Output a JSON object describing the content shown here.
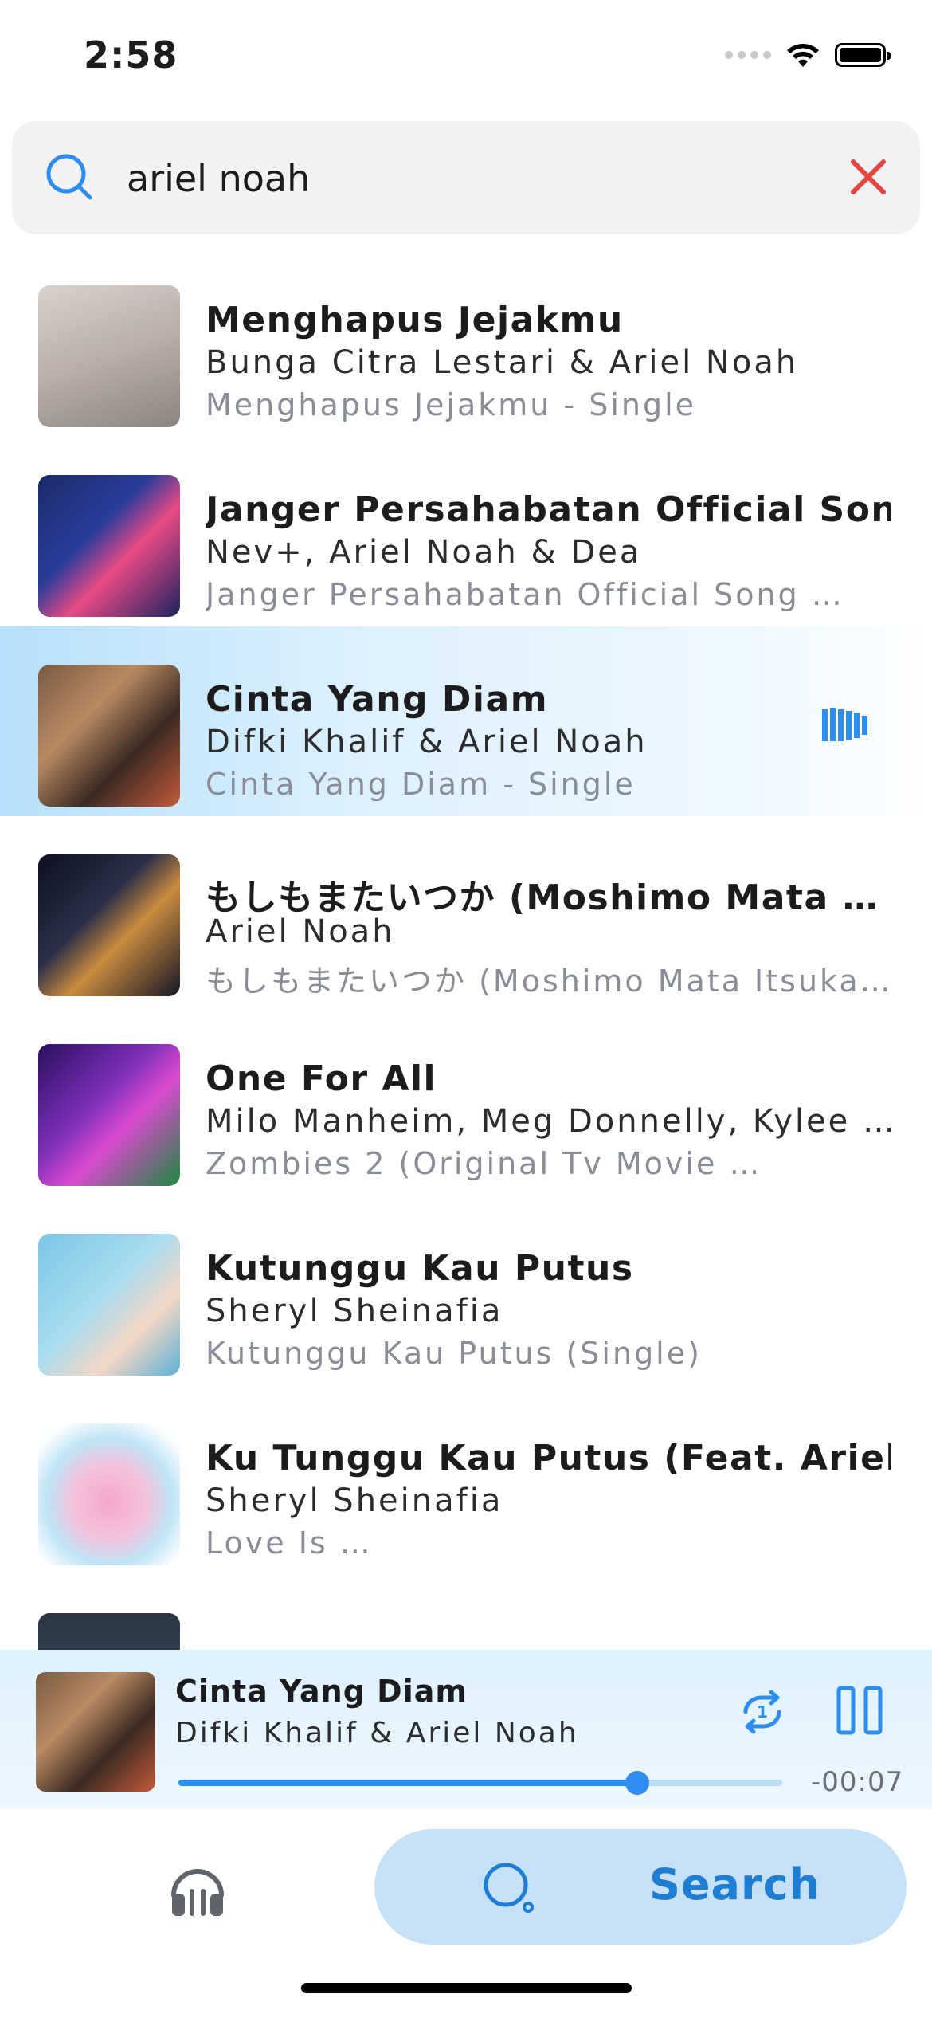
{
  "status_bar": {
    "time": "2:58"
  },
  "search": {
    "query": "ariel noah"
  },
  "results": [
    {
      "title": "Menghapus Jejakmu",
      "artist": "Bunga Citra Lestari & Ariel Noah",
      "album": "Menghapus Jejakmu - Single",
      "art_icon": "album-art"
    },
    {
      "title": "Janger Persahabatan Official Song …",
      "artist": "Nev+, Ariel Noah & Dea",
      "album": "Janger Persahabatan Official Song …",
      "art_icon": "album-art"
    },
    {
      "title": "Cinta Yang Diam",
      "artist": "Difki Khalif & Ariel Noah",
      "album": "Cinta Yang Diam - Single",
      "art_icon": "album-art",
      "playing": true
    },
    {
      "title": "もしもまたいつか (Moshimo Mata …",
      "artist": "Ariel Noah",
      "album": "もしもまたいつか (Moshimo Mata Itsuka…",
      "art_icon": "album-art"
    },
    {
      "title": "One For All",
      "artist": "Milo Manheim, Meg Donnelly, Kylee …",
      "album": "Zombies 2 (Original Tv Movie …",
      "art_icon": "album-art"
    },
    {
      "title": "Kutunggu Kau Putus",
      "artist": "Sheryl Sheinafia",
      "album": "Kutunggu Kau Putus (Single)",
      "art_icon": "album-art"
    },
    {
      "title": "Ku Tunggu Kau Putus (Feat. Ariel …",
      "artist": "Sheryl Sheinafia",
      "album": "Love Is …",
      "art_icon": "album-art"
    },
    {
      "title": "",
      "artist": "",
      "album": "",
      "art_icon": "album-art"
    }
  ],
  "now_playing": {
    "title": "Cinta Yang Diam",
    "artist": "Difki Khalif & Ariel Noah",
    "time_remaining": "-00:07",
    "progress": 0.76,
    "repeat_icon": "repeat-one-icon",
    "pause_icon": "pause-icon"
  },
  "tab_bar": {
    "library_icon": "headphones-icon",
    "search_label": "Search",
    "search_icon": "search-icon"
  },
  "colors": {
    "accent": "#2d8ef0",
    "clear": "#e5453f",
    "search_tab_bg": "#c6e1f6",
    "search_tab_text": "#1e7ed4",
    "active_row": "#b6e0fb"
  }
}
